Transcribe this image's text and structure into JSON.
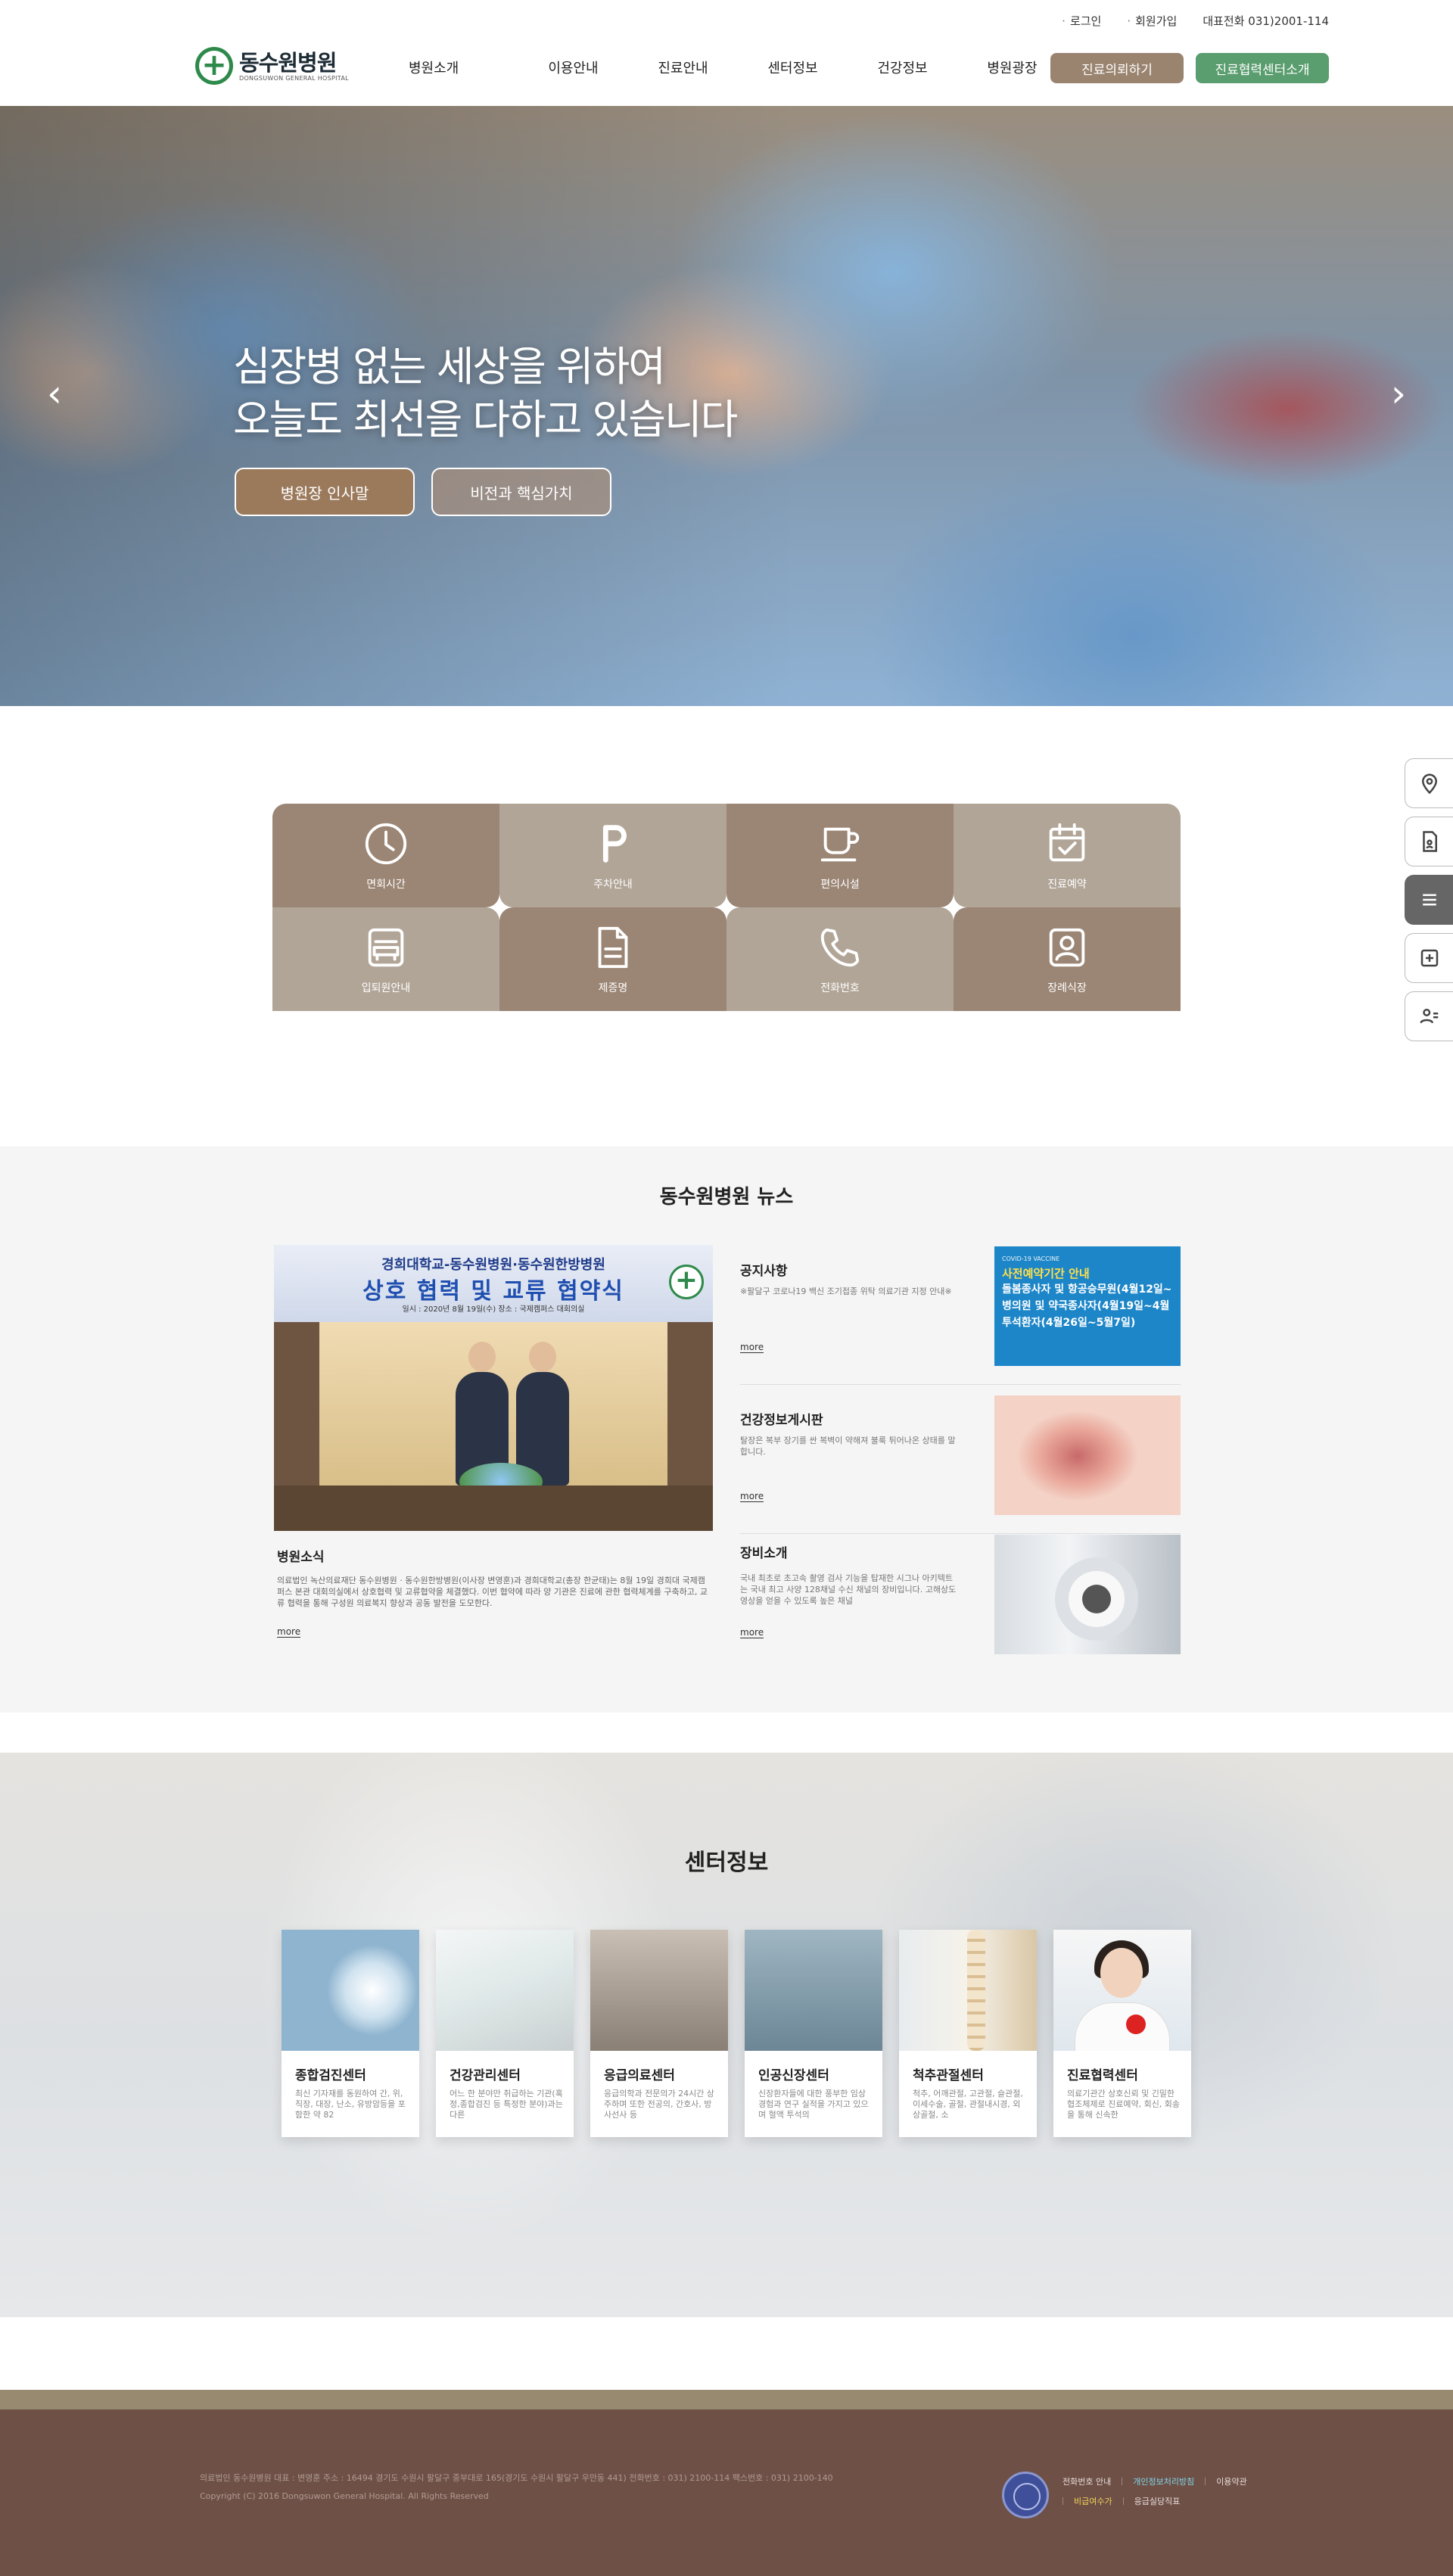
{
  "header": {
    "util_links": [
      "로그인",
      "회원가입"
    ],
    "phone": "대표전화 031)2001-114",
    "logo_ko": "동수원병원",
    "logo_en": "DONGSUWON GENERAL HOSPITAL",
    "nav": [
      "병원소개",
      "이용안내",
      "진료안내",
      "센터정보",
      "건강정보",
      "병원광장"
    ],
    "btn_consult": "진료의뢰하기",
    "btn_cooperation": "진료협력센터소개"
  },
  "hero": {
    "line1": "심장병 없는 세상을 위하여",
    "line2": "오늘도 최선을 다하고 있습니다",
    "btn_greeting": "병원장 인사말",
    "btn_vision": "비전과 핵심가치",
    "prev": "‹",
    "next": "›"
  },
  "quick_side": [
    "location-icon",
    "document-icon",
    "menu-icon",
    "hospital-cross-icon",
    "people-icon"
  ],
  "quick_menu": [
    {
      "label": "면회시간",
      "icon": "clock-icon"
    },
    {
      "label": "주차안내",
      "icon": "parking-icon"
    },
    {
      "label": "편의시설",
      "icon": "cafe-icon"
    },
    {
      "label": "진료예약",
      "icon": "calendar-check-icon"
    },
    {
      "label": "입퇴원안내",
      "icon": "bed-icon"
    },
    {
      "label": "제증명",
      "icon": "certificate-icon"
    },
    {
      "label": "전화번호",
      "icon": "phone-icon"
    },
    {
      "label": "장례식장",
      "icon": "portrait-icon"
    }
  ],
  "news": {
    "title": "동수원병원 뉴스",
    "banner": {
      "line1": "경희대학교-동수원병원·동수원한방병원",
      "line2": "상호 협력 및 교류 협약식",
      "line3": "일시 : 2020년 8월 19일(수)      장소 : 국제캠퍼스 대회의실"
    },
    "main": {
      "title": "병원소식",
      "body": "의료법인 녹산의료재단 동수원병원 · 동수원한방병원(이사장 변영훈)과 경희대학교(총장 한균태)는 8월 19일 경희대 국제캠퍼스 본관 대회의실에서 상호협력 및 교류협약을 체결했다. 이번 협약에 따라 양 기관은 진료에 관한 협력체계를 구축하고, 교류 협력을 통해 구성원 의료복지 향상과 공동 발전을 도모한다.",
      "more": "more"
    },
    "items": [
      {
        "title": "공지사항",
        "body": "※팔달구 코로나19 백신 조기접종 위탁 의료기관 지정 안내※",
        "more": "more"
      },
      {
        "title": "건강정보게시판",
        "body": "탈장은 복부 장기를 싼 복벽이 약해져 불룩 튀어나온 상태를 말합니다.",
        "more": "more"
      },
      {
        "title": "장비소개",
        "body": "국내 최초로 초고속 촬영 검사 기능을 탑재한 시그나 아키텍트는 국내 최고 사양 128채널 수신 채널의 장비입니다. 고해상도 영상을 얻을 수 있도록 높은 채널",
        "more": "more"
      }
    ],
    "covid": {
      "small": "COVID-19 VACCINE",
      "title": "사전예약기간 안내",
      "lines": [
        "돌봄종사자 및 항공승무원(4월12일~",
        "병의원 및 약국종사자(4월19일~4월",
        "투석환자(4월26일~5월7일)"
      ]
    }
  },
  "centers": {
    "title": "센터정보",
    "items": [
      {
        "name": "종합검진센터",
        "desc": "최신 기자재를 동원하여 간, 위, 직장, 대장, 난소, 유방암등을 포함한 약 82"
      },
      {
        "name": "건강관리센터",
        "desc": "어느 한 분야만 취급하는 기관(혹정,종합검진 등 특정한 분야)과는 다른"
      },
      {
        "name": "응급의료센터",
        "desc": "응급의학과 전문의가 24시간 상주하며 또한 전공의, 간호사, 방사선사 등"
      },
      {
        "name": "인공신장센터",
        "desc": "신장환자들에 대한 풍부한 임상경험과 연구 실적을 가지고 있으며 혈액 투석의"
      },
      {
        "name": "척추관절센터",
        "desc": "척추, 어깨관절, 고관절, 슬관절, 이세수술, 골절, 관절내시경, 외상골절, 소"
      },
      {
        "name": "진료협력센터",
        "desc": "의료기관간 상호신뢰 및 긴밀한 협조체제로 진료예약, 회신, 회송을 통해 신속한"
      }
    ]
  },
  "footer": {
    "address": "의료법인 동수원병원   대표 : 변영훈   주소 : 16494 경기도 수원시 팔달구 중부대로 165(경기도 수원시 팔달구 우만동 441)   전화번호 : 031) 2100-114   팩스번호 : 031) 2100-140",
    "copyright": "Copyright (C) 2016 Dongsuwon General Hospital. All Rights Reserved",
    "links_row1": [
      "전화번호 안내",
      "개인정보처리방침",
      "이용약관"
    ],
    "links_row2": [
      "비급여수가",
      "응급실당직표"
    ]
  }
}
